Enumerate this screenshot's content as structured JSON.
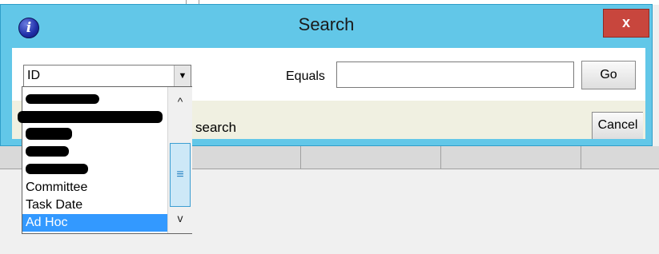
{
  "dialog": {
    "title": "Search",
    "close_label": "x",
    "info_icon_glyph": "i"
  },
  "search": {
    "field_value": "ID",
    "operator_label": "Equals",
    "query_value": "",
    "go_label": "Go",
    "cancel_label": "Cancel",
    "status_text": "search"
  },
  "dropdown": {
    "options": [
      {
        "label": "",
        "redacted": true
      },
      {
        "label": "",
        "redacted": true
      },
      {
        "label": "",
        "redacted": true
      },
      {
        "label": "",
        "redacted": true
      },
      {
        "label": "",
        "redacted": true
      },
      {
        "label": "Committee",
        "redacted": false
      },
      {
        "label": "Task Date",
        "redacted": false
      },
      {
        "label": "Ad Hoc",
        "redacted": false,
        "selected": true
      }
    ],
    "scroll_up_glyph": "^",
    "scroll_down_glyph": "v",
    "thumb_glyph": "≡"
  },
  "colors": {
    "titlebar": "#62c7e8",
    "close_button": "#c8463d",
    "selection": "#3399ff"
  },
  "icons": [
    "info-icon",
    "close-icon",
    "chevron-down-icon",
    "scroll-up-icon",
    "scroll-down-icon"
  ]
}
